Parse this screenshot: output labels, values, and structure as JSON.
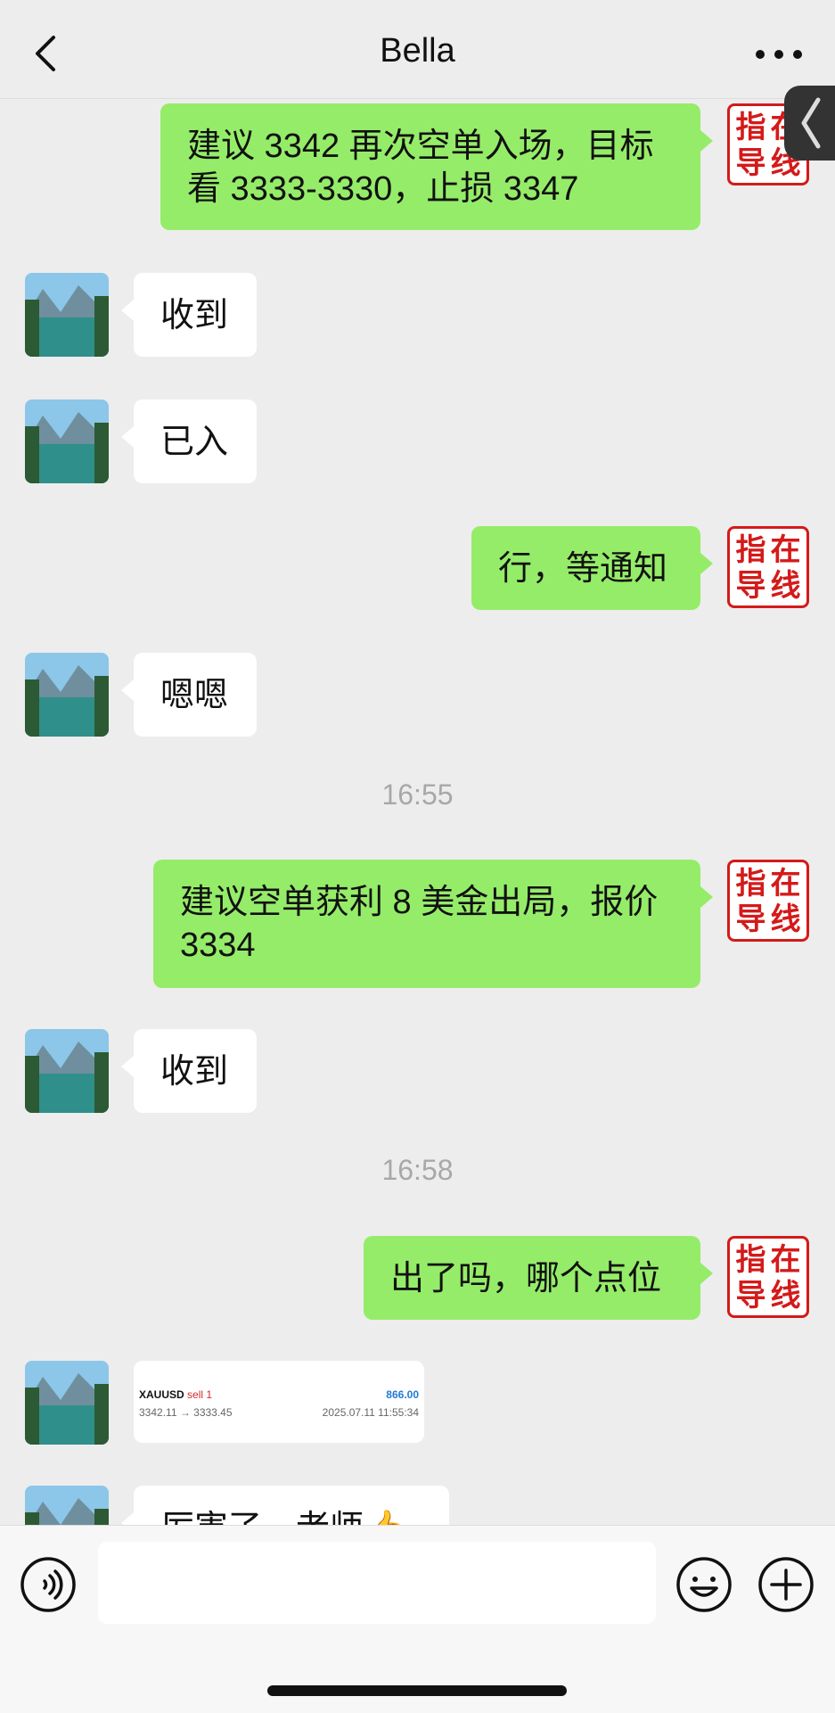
{
  "header": {
    "title": "Bella",
    "back_icon": "chevron-left-icon",
    "more_icon": "ellipsis-icon"
  },
  "seal": {
    "chars": [
      "指",
      "在",
      "导",
      "线"
    ]
  },
  "messages": [
    {
      "type": "out",
      "text": "建议 3342 再次空单入场，目标看 3333-3330，止损 3347"
    },
    {
      "type": "in",
      "text": "收到"
    },
    {
      "type": "in",
      "text": "已入"
    },
    {
      "type": "out",
      "text": "行，等通知"
    },
    {
      "type": "in",
      "text": "嗯嗯"
    },
    {
      "type": "time",
      "text": "16:55"
    },
    {
      "type": "out",
      "text": "建议空单获利 8 美金出局，报价 3334"
    },
    {
      "type": "in",
      "text": "收到"
    },
    {
      "type": "time",
      "text": "16:58"
    },
    {
      "type": "out",
      "text": "出了吗，哪个点位"
    },
    {
      "type": "in-card"
    },
    {
      "type": "in",
      "text": "厉害了，老师👍"
    }
  ],
  "trade_card": {
    "symbol": "XAUUSD",
    "side": "sell 1",
    "profit": "866.00",
    "prices": "3342.11 → 3333.45",
    "datetime": "2025.07.11 11:55:34"
  },
  "input_bar": {
    "placeholder": "",
    "voice_icon": "voice-icon",
    "emoji_icon": "emoji-icon",
    "plus_icon": "plus-icon"
  },
  "colors": {
    "outgoing_bubble": "#95ec69",
    "incoming_bubble": "#ffffff",
    "background": "#ededed",
    "seal_red": "#d41a1a",
    "profit_blue": "#1f7bd8",
    "sell_red": "#d12a2a"
  }
}
